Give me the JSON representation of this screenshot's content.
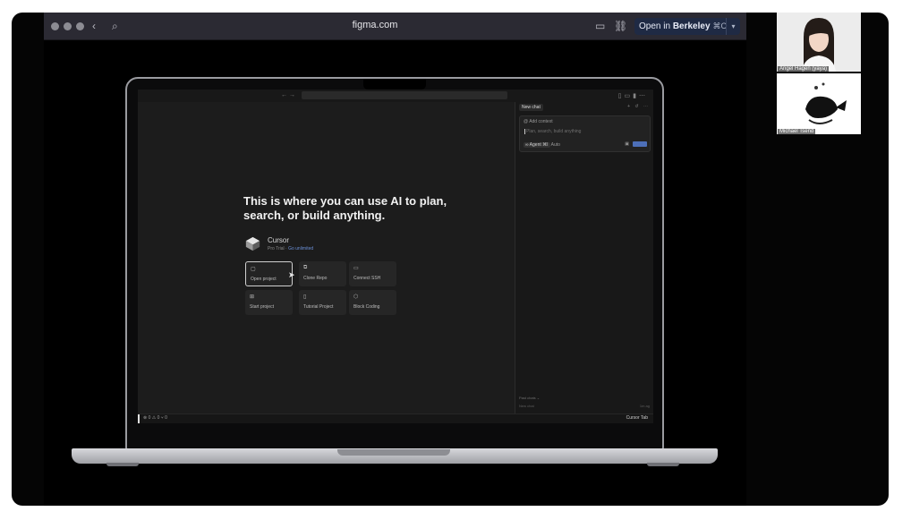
{
  "browser": {
    "url": "figma.com",
    "open_in_label_prefix": "Open in ",
    "open_in_app": "Berkeley",
    "open_in_shortcut": "⌘O"
  },
  "screen": {
    "headline": "This is where you can use AI to plan, search, or build anything.",
    "app_name": "Cursor",
    "plan": "Pro Trial",
    "plan_link": "Go unlimited",
    "tiles": [
      {
        "label": "Open project",
        "icon": "file-icon"
      },
      {
        "label": "Clone Repo",
        "icon": "clone-icon"
      },
      {
        "label": "Connect SSH",
        "icon": "monitor-icon"
      },
      {
        "label": "Start project",
        "icon": "plus-square-icon"
      },
      {
        "label": "Tutorial Project",
        "icon": "book-icon"
      },
      {
        "label": "Block Coding",
        "icon": "cube-icon"
      }
    ],
    "status_left": "⊗ 0 ⚠ 0   ⑂ 0",
    "status_right": "Cursor Tab"
  },
  "chat": {
    "tab": "New chat",
    "add_context": "@ Add context",
    "placeholder": "Plan, search, build anything",
    "agent_label": "∞ Agent ⌘I",
    "mode": "Auto",
    "past_chats": "Past chats ⌄",
    "new_chat": "New chat",
    "time": "1m ag"
  },
  "participants": [
    {
      "name": "Angel Hagen (yaya)"
    },
    {
      "name": "Michael Tsend"
    }
  ],
  "colors": {
    "accent": "#4d6fb8",
    "toolbar": "#2b2a33",
    "editor_bg": "#1c1c1c"
  }
}
